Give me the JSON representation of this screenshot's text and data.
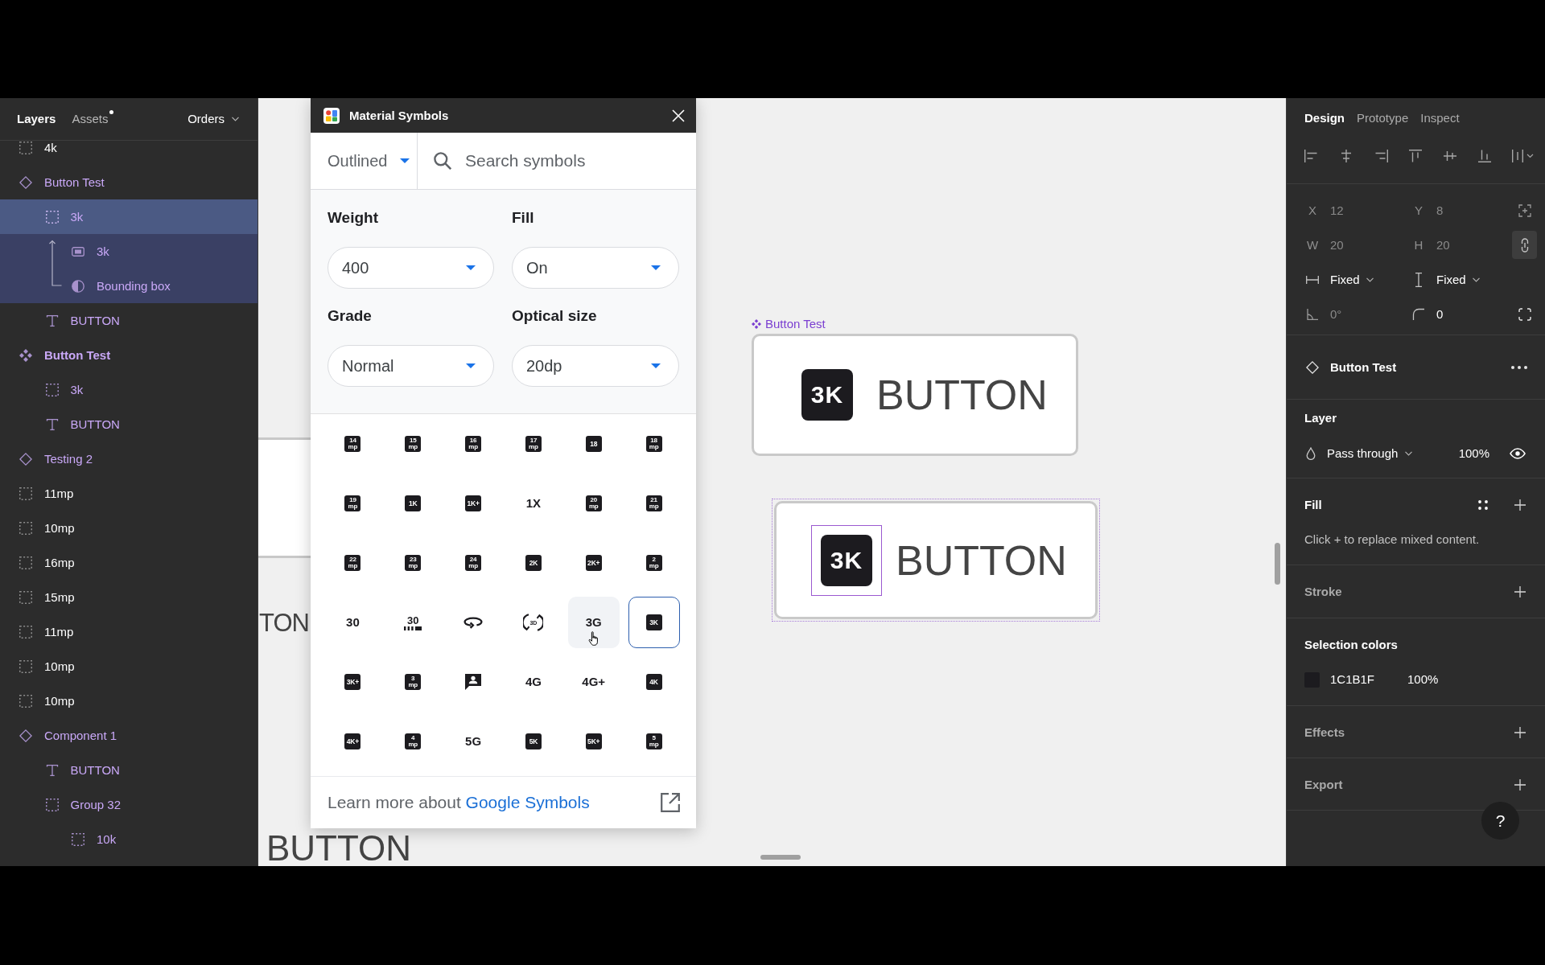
{
  "layers_panel": {
    "tabs": [
      {
        "label": "Layers",
        "selected": true,
        "unread": false
      },
      {
        "label": "Assets",
        "selected": false,
        "unread": true
      }
    ],
    "page": "Orders",
    "layers": [
      {
        "name": "4k",
        "kind": "group",
        "selected": false
      },
      {
        "name": "Button Test",
        "kind": "instance",
        "selected": false,
        "children": [
          {
            "name": "3k",
            "kind": "group",
            "selected": true,
            "children": [
              {
                "name": "3k",
                "kind": "shape",
                "selected": false
              },
              {
                "name": "Bounding box",
                "kind": "mask",
                "selected": false
              }
            ]
          },
          {
            "name": "BUTTON",
            "kind": "text",
            "selected": false
          }
        ]
      },
      {
        "name": "Button Test",
        "kind": "component",
        "selected": false,
        "children": [
          {
            "name": "3k",
            "kind": "group",
            "selected": false
          },
          {
            "name": "BUTTON",
            "kind": "text",
            "selected": false
          }
        ]
      },
      {
        "name": "Testing 2",
        "kind": "instance",
        "selected": false
      },
      {
        "name": "11mp",
        "kind": "group",
        "selected": false
      },
      {
        "name": "10mp",
        "kind": "group",
        "selected": false
      },
      {
        "name": "16mp",
        "kind": "group",
        "selected": false
      },
      {
        "name": "15mp",
        "kind": "group",
        "selected": false
      },
      {
        "name": "11mp",
        "kind": "group",
        "selected": false
      },
      {
        "name": "10mp",
        "kind": "group",
        "selected": false
      },
      {
        "name": "10mp",
        "kind": "group",
        "selected": false
      },
      {
        "name": "Component 1",
        "kind": "instance",
        "selected": false,
        "children": [
          {
            "name": "BUTTON",
            "kind": "text",
            "selected": false
          },
          {
            "name": "Group 32",
            "kind": "group",
            "selected": false,
            "children": [
              {
                "name": "10k",
                "kind": "group",
                "selected": false
              }
            ]
          }
        ]
      }
    ]
  },
  "canvas": {
    "left_fragment": "TON",
    "bottom_fragment": "BUTTON",
    "component": {
      "label": "Button Test",
      "symbol": "3K",
      "text": "BUTTON"
    },
    "instance": {
      "highlighted": true,
      "symbol_selected": true,
      "symbol": "3K",
      "text": "BUTTON"
    }
  },
  "plugin": {
    "title": "Material Symbols",
    "style": "Outlined",
    "search": {
      "placeholder": "Search symbols"
    },
    "settings": [
      {
        "label": "Weight",
        "value": "400"
      },
      {
        "label": "Fill",
        "value": "On"
      },
      {
        "label": "Grade",
        "value": "Normal"
      },
      {
        "label": "Optical size",
        "value": "20dp"
      }
    ],
    "symbols": [
      {
        "kind": "badge",
        "text": "14",
        "sub": "mp",
        "selected": false,
        "hovered": false
      },
      {
        "kind": "badge",
        "text": "15",
        "sub": "mp",
        "selected": false,
        "hovered": false
      },
      {
        "kind": "badge",
        "text": "16",
        "sub": "mp",
        "selected": false,
        "hovered": false
      },
      {
        "kind": "badge",
        "text": "17",
        "sub": "mp",
        "selected": false,
        "hovered": false
      },
      {
        "kind": "badge",
        "text": "18",
        "selected": false,
        "hovered": false
      },
      {
        "kind": "badge",
        "text": "18",
        "sub": "mp",
        "selected": false,
        "hovered": false
      },
      {
        "kind": "badge",
        "text": "19",
        "sub": "mp",
        "selected": false,
        "hovered": false
      },
      {
        "kind": "badge",
        "text": "1K",
        "selected": false,
        "hovered": false
      },
      {
        "kind": "badge",
        "text": "1K+",
        "selected": false,
        "hovered": false
      },
      {
        "kind": "plain",
        "text": "1X",
        "selected": false,
        "hovered": false
      },
      {
        "kind": "badge",
        "text": "20",
        "sub": "mp",
        "selected": false,
        "hovered": false
      },
      {
        "kind": "badge",
        "text": "21",
        "sub": "mp",
        "selected": false,
        "hovered": false
      },
      {
        "kind": "badge",
        "text": "22",
        "sub": "mp",
        "selected": false,
        "hovered": false
      },
      {
        "kind": "badge",
        "text": "23",
        "sub": "mp",
        "selected": false,
        "hovered": false
      },
      {
        "kind": "badge",
        "text": "24",
        "sub": "mp",
        "selected": false,
        "hovered": false
      },
      {
        "kind": "badge",
        "text": "2K",
        "selected": false,
        "hovered": false
      },
      {
        "kind": "badge",
        "text": "2K+",
        "selected": false,
        "hovered": false
      },
      {
        "kind": "badge",
        "text": "2",
        "sub": "mp",
        "selected": false,
        "hovered": false
      },
      {
        "kind": "plain",
        "text": "30",
        "selected": false,
        "hovered": false
      },
      {
        "kind": "fps-select",
        "text": "30",
        "selected": false,
        "hovered": false
      },
      {
        "kind": "rotate-360",
        "selected": false,
        "hovered": false
      },
      {
        "kind": "rotate-3d",
        "text": "3D",
        "selected": false,
        "hovered": false
      },
      {
        "kind": "plain",
        "text": "3G",
        "selected": false,
        "hovered": true
      },
      {
        "kind": "badge",
        "text": "3K",
        "selected": true,
        "hovered": false
      },
      {
        "kind": "badge",
        "text": "3K+",
        "selected": false,
        "hovered": false
      },
      {
        "kind": "badge",
        "text": "3",
        "sub": "mp",
        "selected": false,
        "hovered": false
      },
      {
        "kind": "chat-person",
        "selected": false,
        "hovered": false
      },
      {
        "kind": "plain",
        "text": "4G",
        "selected": false,
        "hovered": false
      },
      {
        "kind": "plain",
        "text": "4G+",
        "selected": false,
        "hovered": false
      },
      {
        "kind": "badge",
        "text": "4K",
        "selected": false,
        "hovered": false
      },
      {
        "kind": "badge",
        "text": "4K+",
        "selected": false,
        "hovered": false
      },
      {
        "kind": "badge",
        "text": "4",
        "sub": "mp",
        "selected": false,
        "hovered": false
      },
      {
        "kind": "plain",
        "text": "5G",
        "selected": false,
        "hovered": false
      },
      {
        "kind": "badge",
        "text": "5K",
        "selected": false,
        "hovered": false
      },
      {
        "kind": "badge",
        "text": "5K+",
        "selected": false,
        "hovered": false
      },
      {
        "kind": "badge",
        "text": "5",
        "sub": "mp",
        "selected": false,
        "hovered": false
      }
    ],
    "footer": {
      "text": "Learn more about",
      "link": "Google Symbols"
    }
  },
  "design_panel": {
    "tabs": [
      {
        "label": "Design",
        "selected": true
      },
      {
        "label": "Prototype",
        "selected": false
      },
      {
        "label": "Inspect",
        "selected": false
      }
    ],
    "position": [
      {
        "label": "X",
        "value": "12",
        "disabled": true
      },
      {
        "label": "Y",
        "value": "8",
        "disabled": true
      }
    ],
    "size": [
      {
        "label": "W",
        "value": "20",
        "disabled": true
      },
      {
        "label": "H",
        "value": "20",
        "disabled": true
      }
    ],
    "constrain_proportions": true,
    "resizing": [
      {
        "kind": "horizontal",
        "value": "Fixed"
      },
      {
        "kind": "vertical",
        "value": "Fixed"
      }
    ],
    "rotation": {
      "value": "0°",
      "disabled": true
    },
    "corner_radius": {
      "value": "0",
      "disabled": false
    },
    "component": {
      "name": "Button Test"
    },
    "sections": [
      {
        "kind": "layer",
        "title": "Layer",
        "empty": false,
        "blend": "Pass through",
        "opacity": "100%",
        "visible": true
      },
      {
        "kind": "fill",
        "title": "Fill",
        "empty": false,
        "note": "Click + to replace mixed content."
      },
      {
        "kind": "stroke",
        "title": "Stroke",
        "empty": true
      },
      {
        "kind": "selection-colors",
        "title": "Selection colors",
        "empty": false,
        "colors": [
          {
            "hex": "1C1B1F",
            "opacity": "100%",
            "color": "#1c1b1f"
          }
        ]
      },
      {
        "kind": "effects",
        "title": "Effects",
        "empty": true
      },
      {
        "kind": "export",
        "title": "Export",
        "empty": true
      }
    ],
    "help": "?"
  }
}
